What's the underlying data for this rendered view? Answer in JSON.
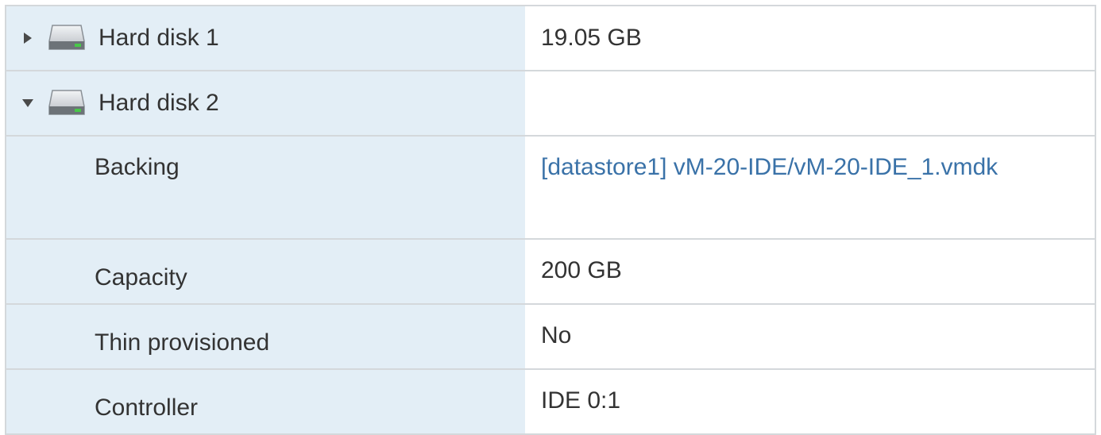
{
  "rows": [
    {
      "label": "Hard disk 1",
      "value": "19.05 GB",
      "expanded": false
    },
    {
      "label": "Hard disk 2",
      "value": "",
      "expanded": true
    },
    {
      "label": "Backing",
      "value": "[datastore1] vM-20-IDE/vM-20-IDE_1.vmdk"
    },
    {
      "label": "Capacity",
      "value": "200 GB"
    },
    {
      "label": "Thin provisioned",
      "value": "No"
    },
    {
      "label": "Controller",
      "value": "IDE 0:1"
    }
  ],
  "icons": {
    "collapsed": "chevron-right-icon",
    "expanded": "chevron-down-icon",
    "disk": "hard-disk-icon"
  },
  "colors": {
    "label_bg": "#e3eef6",
    "border": "#d4d8db",
    "link": "#3a72a8",
    "text": "#333333"
  }
}
